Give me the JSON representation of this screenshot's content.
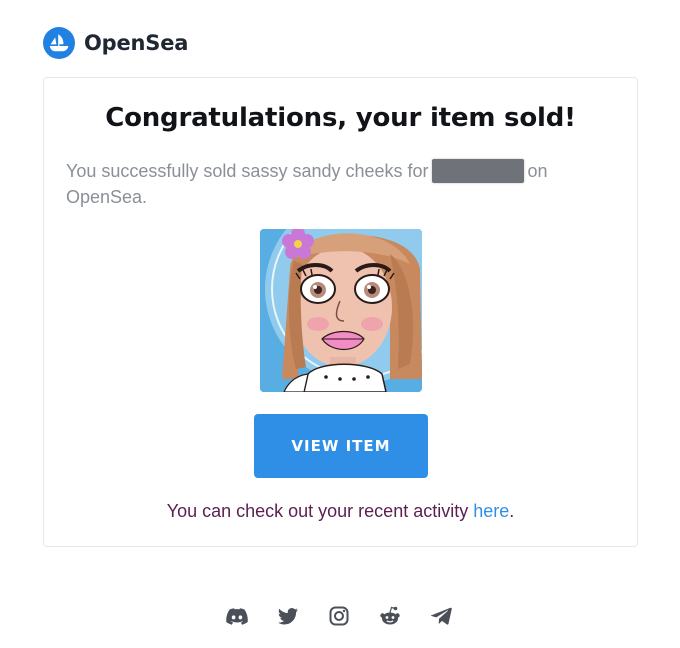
{
  "brand": {
    "name": "OpenSea",
    "accent": "#2081e2"
  },
  "card": {
    "title": "Congratulations, your item sold!",
    "message_before": "You successfully sold sassy sandy cheeks for",
    "message_after": "on OpenSea.",
    "item_alt": "sassy sandy cheeks",
    "button_label": "VIEW ITEM",
    "activity_text": "You can check out your recent activity ",
    "activity_link": "here",
    "activity_end": "."
  },
  "colors": {
    "button": "#2f8fe6",
    "activity_text": "#5a1f4f",
    "link": "#2f8fe6"
  },
  "footer": {
    "social_icons": [
      "discord-icon",
      "twitter-icon",
      "instagram-icon",
      "reddit-icon",
      "telegram-icon"
    ]
  }
}
